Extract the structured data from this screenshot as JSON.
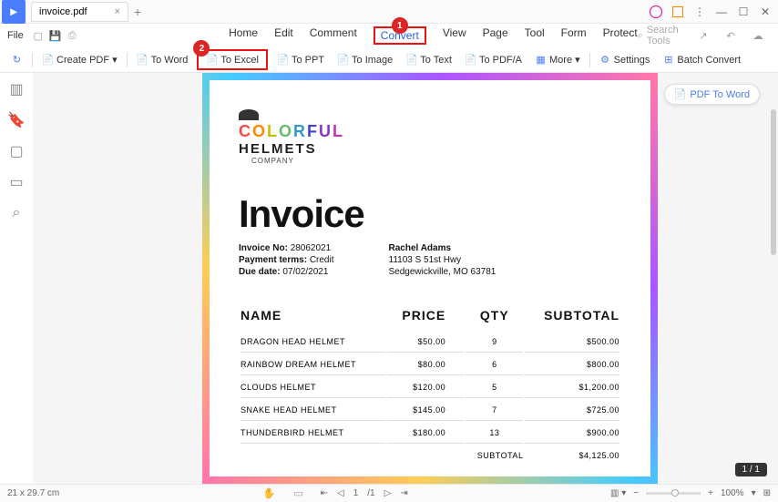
{
  "titlebar": {
    "tab_name": "invoice.pdf"
  },
  "menu": {
    "file": "File",
    "items": [
      "Home",
      "Edit",
      "Comment",
      "Convert",
      "View",
      "Page",
      "Tool",
      "Form",
      "Protect"
    ],
    "search_placeholder": "Search Tools"
  },
  "badges": {
    "one": "1",
    "two": "2"
  },
  "toolbar": {
    "create": "Create PDF",
    "to_word": "To Word",
    "to_excel": "To Excel",
    "to_ppt": "To PPT",
    "to_image": "To Image",
    "to_text": "To Text",
    "to_pdfa": "To PDF/A",
    "more": "More",
    "settings": "Settings",
    "batch": "Batch Convert"
  },
  "float": {
    "pdf_to_word": "PDF To Word",
    "page_indicator": "1 / 1"
  },
  "doc": {
    "logo_sub": "HELMETS",
    "logo_company": "COMPANY",
    "title": "Invoice",
    "invoice_no_label": "Invoice No:",
    "invoice_no": "28062021",
    "payment_label": "Payment terms:",
    "payment": "Credit",
    "due_label": "Due date:",
    "due": "07/02/2021",
    "customer_name": "Rachel Adams",
    "addr1": "11103 S 51st Hwy",
    "addr2": "Sedgewickville, MO 63781",
    "headers": {
      "name": "NAME",
      "price": "PRICE",
      "qty": "QTY",
      "subtotal": "SUBTOTAL"
    },
    "rows": [
      {
        "name": "DRAGON HEAD HELMET",
        "price": "$50.00",
        "qty": "9",
        "sub": "$500.00"
      },
      {
        "name": "RAINBOW DREAM HELMET",
        "price": "$80.00",
        "qty": "6",
        "sub": "$800.00"
      },
      {
        "name": "CLOUDS HELMET",
        "price": "$120.00",
        "qty": "5",
        "sub": "$1,200.00"
      },
      {
        "name": "SNAKE HEAD HELMET",
        "price": "$145.00",
        "qty": "7",
        "sub": "$725.00"
      },
      {
        "name": "THUNDERBIRD HELMET",
        "price": "$180.00",
        "qty": "13",
        "sub": "$900.00"
      }
    ],
    "subtotal_label": "SUBTOTAL",
    "subtotal": "$4,125.00"
  },
  "status": {
    "dims": "21 x 29.7 cm",
    "page_input": "1",
    "page_total": "/1",
    "zoom": "100%"
  }
}
